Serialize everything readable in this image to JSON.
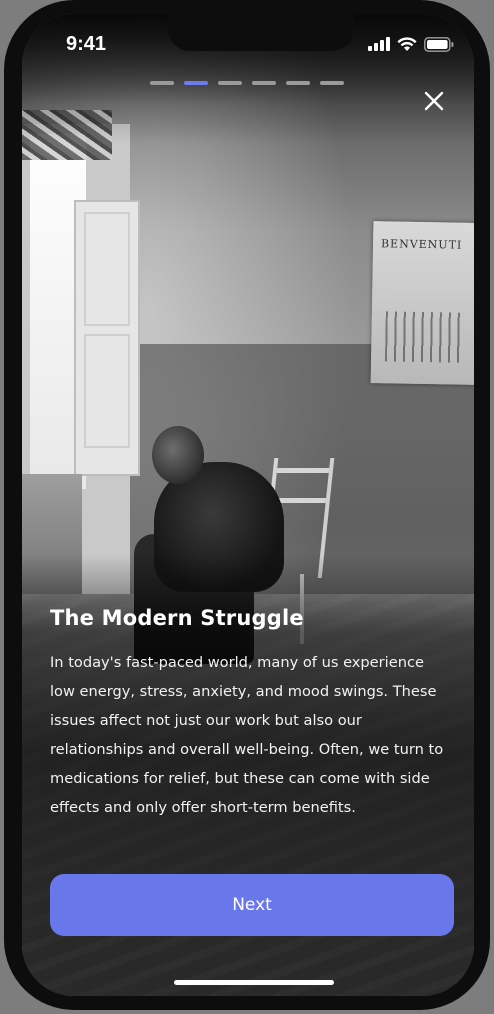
{
  "status_bar": {
    "time": "9:41",
    "icons": [
      "signal-icon",
      "wifi-icon",
      "battery-icon"
    ]
  },
  "onboarding": {
    "steps_total": 6,
    "current_step": 2,
    "title": "The Modern Struggle",
    "body": "In today's fast-paced world, many of us experience low energy, stress, anxiety, and mood swings. These issues affect not just our work but also our relationships and overall well-being. Often, we turn to medications for relief, but these can come with side effects and only offer short-term benefits.",
    "next_label": "Next",
    "close_icon": "close-icon",
    "poster_text": "BENVENUTI"
  },
  "colors": {
    "accent": "#6878ea",
    "progress_inactive": "#9a9a9a",
    "text": "#ffffff"
  }
}
